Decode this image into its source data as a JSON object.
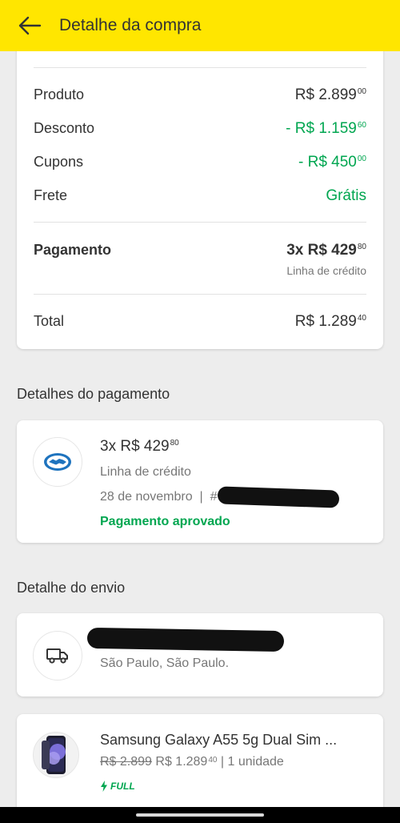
{
  "header": {
    "title": "Detalhe da compra",
    "back_icon": "arrow-left-icon"
  },
  "summary": {
    "rows": [
      {
        "label": "Produto",
        "value": "R$ 2.899",
        "cents": "00"
      },
      {
        "label": "Desconto",
        "value": "- R$ 1.159",
        "cents": "60"
      },
      {
        "label": "Cupons",
        "value": "- R$ 450",
        "cents": "00"
      },
      {
        "label": "Frete",
        "value": "Grátis"
      }
    ],
    "payment": {
      "label": "Pagamento",
      "value": "3x R$ 429",
      "cents": "80",
      "note": "Linha de crédito"
    },
    "total": {
      "label": "Total",
      "value": "R$ 1.289",
      "cents": "40"
    }
  },
  "payment_details": {
    "section_title": "Detalhes do pagamento",
    "amount": "3x R$ 429",
    "cents": "80",
    "method": "Linha de crédito",
    "date": "28 de novembro  |  # ",
    "status": "Pagamento aprovado",
    "icon": "mercado-pago-handshake-icon"
  },
  "shipping": {
    "section_title": "Detalhe do envio",
    "city": "São Paulo, São Paulo.",
    "icon": "truck-icon"
  },
  "product": {
    "name": "Samsung Galaxy A55 5g Dual Sim ...",
    "old_price": "R$ 2.899",
    "price": "R$ 1.289",
    "price_cents": "40",
    "quantity": " | 1 unidade",
    "badge": "FULL"
  },
  "colors": {
    "brand_yellow": "#ffe600",
    "success_green": "#00a650"
  }
}
